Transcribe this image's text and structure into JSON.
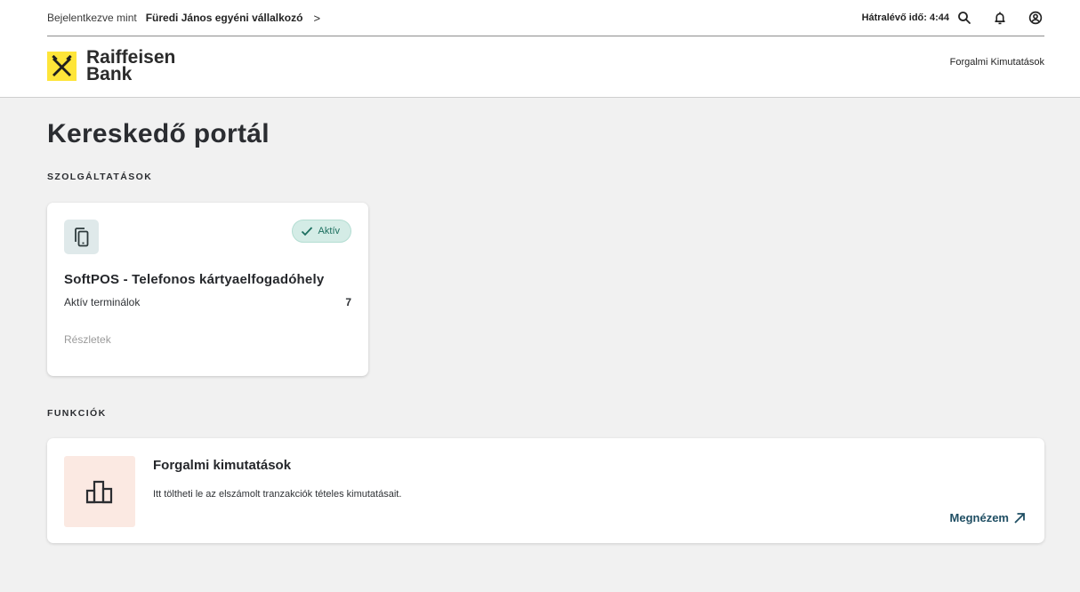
{
  "header": {
    "logged_in_label": "Bejelentkezve mint",
    "user_name": "Füredi János egyéni vállalkozó",
    "user_chevron": ">",
    "timer_text": "Hátralévő idő: 4:44",
    "icons": [
      "search-icon",
      "bell-icon",
      "user-icon"
    ]
  },
  "brand": {
    "line1": "Raiffeisen",
    "line2": "Bank",
    "accent_color": "#fee539"
  },
  "nav": {
    "right_link": "Forgalmi Kimutatások"
  },
  "main": {
    "title": "Kereskedő portál",
    "services_label": "SZOLGÁLTATÁSOK",
    "functions_label": "FUNKCIÓK"
  },
  "service_card": {
    "icon": "phone-copy-icon",
    "badge": "Aktív",
    "badge_color": "#d4ece6",
    "title": "SoftPOS - Telefonos kártyaelfogadóhely",
    "row_label": "Aktív terminálok",
    "row_value": "7",
    "details_link": "Részletek"
  },
  "function_card": {
    "icon": "bar-chart-icon",
    "icon_bg": "#fbe9e2",
    "title": "Forgalmi kimutatások",
    "description": "Itt töltheti le az elszámolt tranzakciók tételes kimutatásait.",
    "link": "Megnézem"
  }
}
